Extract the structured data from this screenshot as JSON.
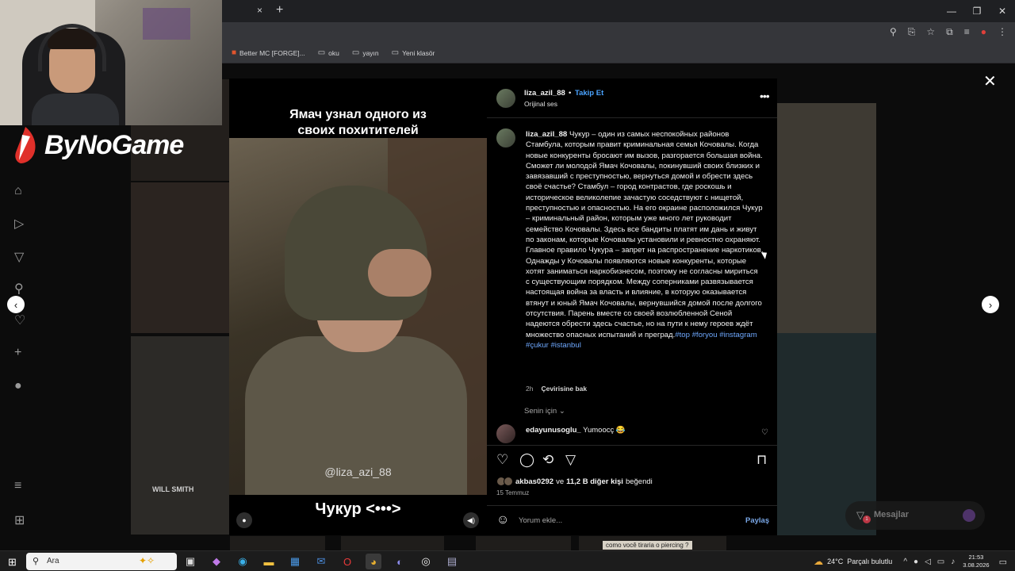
{
  "browser": {
    "tab_close": "×",
    "tab_new": "+",
    "bookmarks": [
      {
        "label": "Better MC [FORGE]...",
        "icon": "favicon-icon"
      },
      {
        "label": "oku",
        "icon": "folder-icon"
      },
      {
        "label": "yayın",
        "icon": "folder-icon"
      },
      {
        "label": "Yeni klasör",
        "icon": "folder-icon"
      }
    ]
  },
  "overlay": {
    "brand": "ByNoGame"
  },
  "background": {
    "will_smith_label": "WILL SMITH",
    "piercing_label": "como você tiraria o piercing ?"
  },
  "video": {
    "caption_top_line1": "Ямач узнал одного из",
    "caption_top_line2": "своих похитителей",
    "watermark": "@liza_azi_88",
    "caption_bottom": "Чукур <•••>"
  },
  "post": {
    "username": "liza_azil_88",
    "separator": "•",
    "follow_label": "Takip Et",
    "audio_label": "Orijinal ses",
    "more_label": "•••",
    "description_user": "liza_azil_88",
    "description_text": "Чукур – один из самых неспокойных районов Стамбула, которым правит криминальная семья Кочовалы. Когда новые конкуренты бросают им вызов, разгорается большая война. Сможет ли молодой Ямач Кочовалы, покинувший своих близких и завязавший с преступностью, вернуться домой и обрести здесь своё счастье? Стамбул – город контрастов, где роскошь и историческое великолепие зачастую соседствуют с нищетой, преступностью и опасностью. На его окраине расположился Чукур – криминальный район, которым уже много лет руководит семейство Кочовалы. Здесь все бандиты платят им дань и живут по законам, которые Кочовалы установили и ревностно охраняют. Главное правило Чукура – запрет на распространение наркотиков. Однажды у Кочовалы появляются новые конкуренты, которые хотят заниматься наркобизнесом, поэтому не согласны мириться с существующим порядком. Между соперниками развязывается настоящая война за власть и влияние, в которую оказывается втянут и юный Ямач Кочовалы, вернувшийся домой после долгого отсутствия. Парень вместе со своей возлюбленной Сеной надеются обрести здесь счастье, но на пути к нему героев ждёт множество опасных испытаний и преград.",
    "hashtags": "#top #foryou #instagram #çukur #istanbul",
    "time_ago": "2h",
    "translate_label": "Çevirisine bak",
    "for_you_label": "Senin için ⌄",
    "comment_user": "edayunusoglu_",
    "comment_text": "Yumoocç 😂",
    "likes_user": "akbas0292",
    "likes_mid": " ve ",
    "likes_count": "11,2 B diğer kişi",
    "likes_suffix": " beğendi",
    "date": "15 Temmuz",
    "comment_placeholder": "Yorum ekle...",
    "share_label": "Paylaş"
  },
  "messages": {
    "label": "Mesajlar",
    "badge": "1"
  },
  "taskbar": {
    "search_label": "Ara",
    "weather_temp": "24°C",
    "weather_text": "Parçalı bulutlu",
    "time": "21:53",
    "date": "3.08.2026"
  },
  "colors": {
    "follow_blue": "#4aa3ff",
    "hashtag_blue": "#6ea8fe",
    "panel_bg": "#000000"
  }
}
